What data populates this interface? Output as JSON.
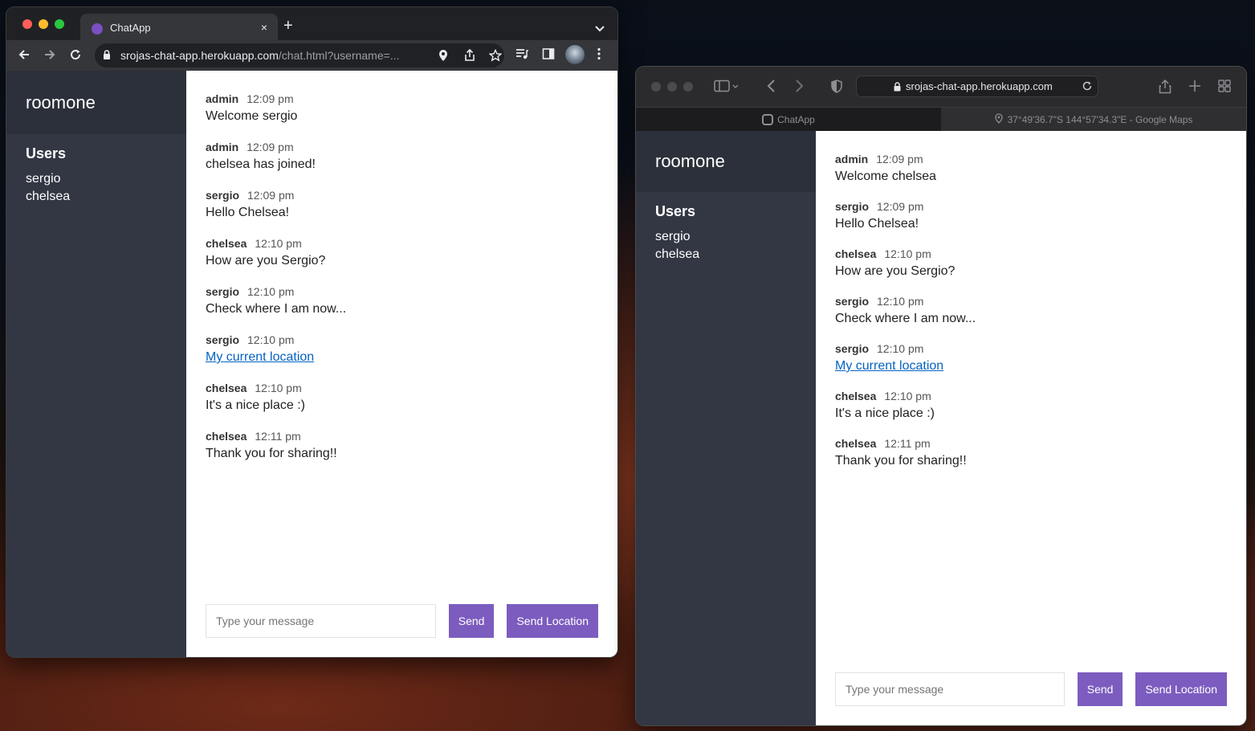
{
  "chrome": {
    "tab_title": "ChatApp",
    "tab_close": "×",
    "new_tab": "+",
    "url_host": "srojas-chat-app.herokuapp.com",
    "url_path": "/chat.html?username=..."
  },
  "safari": {
    "url": "srojas-chat-app.herokuapp.com",
    "tabs": [
      {
        "label": "ChatApp"
      },
      {
        "label": "37°49'36.7\"S 144°57'34.3\"E - Google Maps"
      }
    ]
  },
  "room_a": {
    "room_name": "roomone",
    "users_title": "Users",
    "users": [
      "sergio",
      "chelsea"
    ],
    "messages": [
      {
        "user": "admin",
        "time": "12:09 pm",
        "text": "Welcome sergio"
      },
      {
        "user": "admin",
        "time": "12:09 pm",
        "text": "chelsea has joined!"
      },
      {
        "user": "sergio",
        "time": "12:09 pm",
        "text": "Hello Chelsea!"
      },
      {
        "user": "chelsea",
        "time": "12:10 pm",
        "text": "How are you Sergio?"
      },
      {
        "user": "sergio",
        "time": "12:10 pm",
        "text": "Check where I am now..."
      },
      {
        "user": "sergio",
        "time": "12:10 pm",
        "link": "My current location"
      },
      {
        "user": "chelsea",
        "time": "12:10 pm",
        "text": "It's a nice place :)"
      },
      {
        "user": "chelsea",
        "time": "12:11 pm",
        "text": "Thank you for sharing!!"
      }
    ],
    "input_placeholder": "Type your message",
    "send_label": "Send",
    "send_location_label": "Send Location"
  },
  "room_b": {
    "room_name": "roomone",
    "users_title": "Users",
    "users": [
      "sergio",
      "chelsea"
    ],
    "messages": [
      {
        "user": "admin",
        "time": "12:09 pm",
        "text": "Welcome chelsea"
      },
      {
        "user": "sergio",
        "time": "12:09 pm",
        "text": "Hello Chelsea!"
      },
      {
        "user": "chelsea",
        "time": "12:10 pm",
        "text": "How are you Sergio?"
      },
      {
        "user": "sergio",
        "time": "12:10 pm",
        "text": "Check where I am now..."
      },
      {
        "user": "sergio",
        "time": "12:10 pm",
        "link": "My current location"
      },
      {
        "user": "chelsea",
        "time": "12:10 pm",
        "text": "It's a nice place :)"
      },
      {
        "user": "chelsea",
        "time": "12:11 pm",
        "text": "Thank you for sharing!!"
      }
    ],
    "input_placeholder": "Type your message",
    "send_label": "Send",
    "send_location_label": "Send Location"
  },
  "colors": {
    "accent": "#7c5cbf",
    "sidebar": "#333744",
    "sidebar_header": "#2c303a",
    "link": "#0563c1"
  }
}
